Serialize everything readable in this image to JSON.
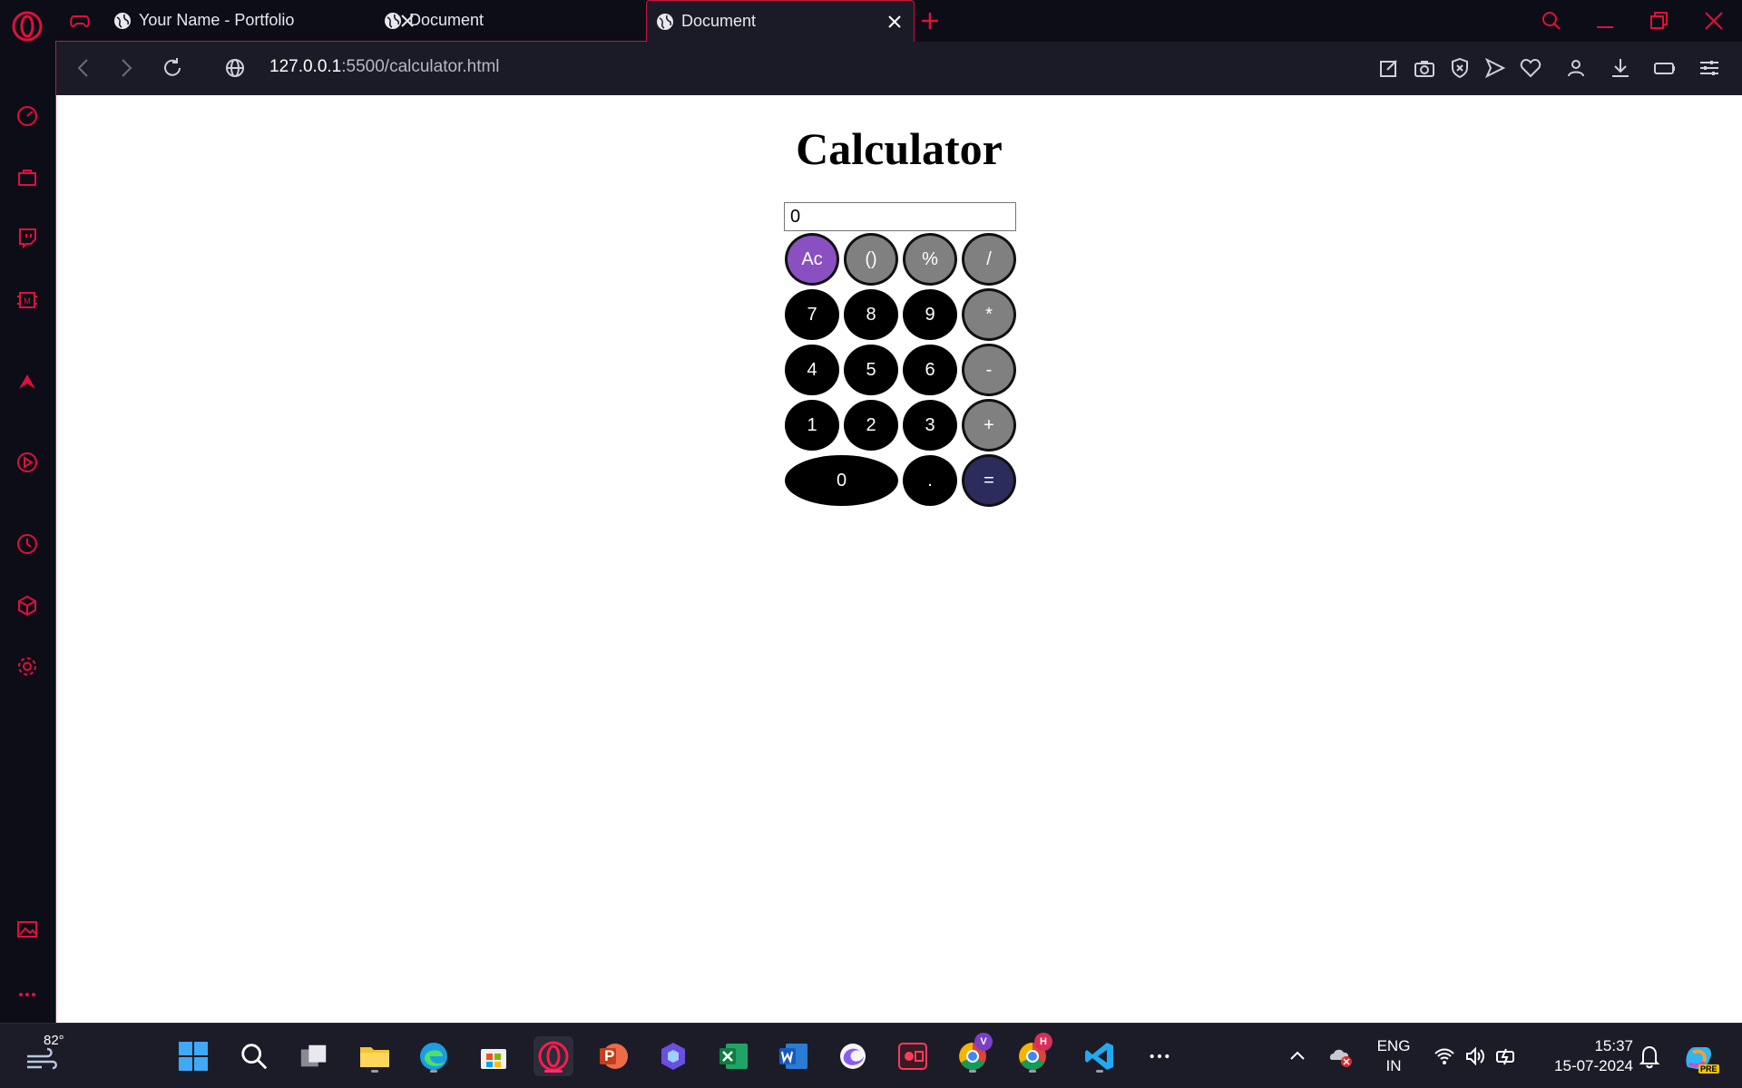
{
  "browser": {
    "tabs": [
      {
        "title": "Your Name - Portfolio",
        "active": false
      },
      {
        "title": "Document",
        "active": false
      },
      {
        "title": "Document",
        "active": true
      }
    ],
    "url_host": "127.0.0.1",
    "url_rest": ":5500/calculator.html",
    "accent_color": "#c8143c"
  },
  "sidebar": {
    "items": [
      "speed-dial-icon",
      "shopping-bag-icon",
      "twitch-icon",
      "memory-chip-icon",
      "aria-icon",
      "player-icon",
      "history-icon",
      "extensions-cube-icon",
      "settings-gear-icon",
      "gallery-icon",
      "more-icon"
    ]
  },
  "page": {
    "title": "Calculator",
    "display_value": "0",
    "keys": {
      "ac": "Ac",
      "paren": "()",
      "percent": "%",
      "divide": "/",
      "seven": "7",
      "eight": "8",
      "nine": "9",
      "multiply": "*",
      "four": "4",
      "five": "5",
      "six": "6",
      "minus": "-",
      "one": "1",
      "two": "2",
      "three": "3",
      "plus": "+",
      "zero": "0",
      "dot": ".",
      "equals": "="
    },
    "colors": {
      "ac": "#8a4fc0",
      "operator": "#808080",
      "number": "#000000",
      "equals": "#2b2b5c"
    }
  },
  "taskbar": {
    "weather_temp": "82°",
    "language": "ENG",
    "region": "IN",
    "time": "15:37",
    "date": "15-07-2024",
    "badge_v": "V",
    "badge_h": "H",
    "copilot_badge": "PRE",
    "ppt_letter": "P"
  }
}
